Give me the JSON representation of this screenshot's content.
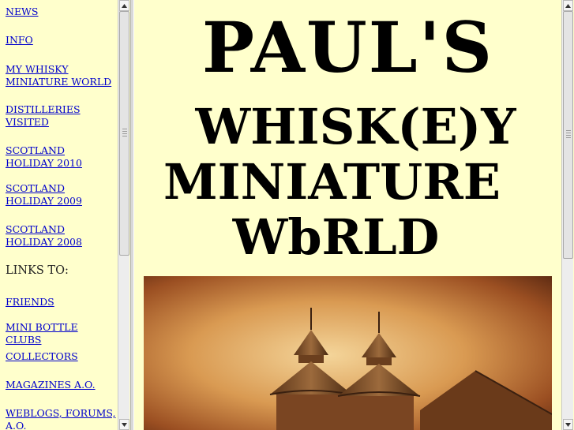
{
  "nav": {
    "links": [
      {
        "label": "NEWS"
      },
      {
        "label": "INFO"
      },
      {
        "label": "MY WHISKY MINIATURE WORLD"
      },
      {
        "label": "DISTILLERIES VISITED"
      },
      {
        "label": "SCOTLAND HOLIDAY 2010"
      },
      {
        "label": "SCOTLAND HOLIDAY 2009"
      },
      {
        "label": "SCOTLAND HOLIDAY 2008"
      }
    ],
    "links_heading": "LINKS TO:",
    "external_links": [
      {
        "label": "FRIENDS"
      },
      {
        "label": "MINI BOTTLE CLUBS"
      },
      {
        "label": "COLLECTORS"
      },
      {
        "label": "MAGAZINES A.O."
      },
      {
        "label": "WEBLOGS, FORUMS, A.O."
      }
    ]
  },
  "main": {
    "title_line1": "PAUL'S",
    "title_line2": "WHISK(E)Y",
    "title_line3": "MINIATURE",
    "title_line4": "WbRLD",
    "hero_image_icon": "pagoda-roof-distillery-image"
  },
  "colors": {
    "background": "#ffffcc",
    "link": "#0000cc",
    "title": "#000000"
  }
}
